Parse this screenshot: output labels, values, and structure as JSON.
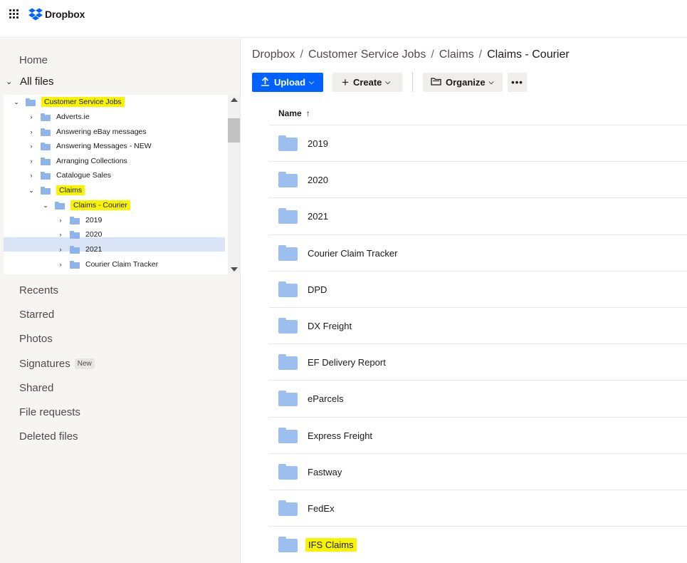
{
  "app": {
    "brand": "Dropbox"
  },
  "sidebar": {
    "home": "Home",
    "all_files": "All files",
    "tree": [
      {
        "label": "Customer Service Jobs",
        "expanded": true,
        "highlight": true
      },
      {
        "label": "Adverts.ie"
      },
      {
        "label": "Answering eBay messages"
      },
      {
        "label": "Answering Messages - NEW"
      },
      {
        "label": "Arranging Collections"
      },
      {
        "label": "Catalogue Sales"
      },
      {
        "label": "Claims",
        "expanded": true,
        "highlight": true
      },
      {
        "label": "Claims - Courier",
        "expanded": true,
        "highlight": true,
        "selected": true
      },
      {
        "label": "2019"
      },
      {
        "label": "2020"
      },
      {
        "label": "2021"
      },
      {
        "label": "Courier Claim Tracker"
      }
    ],
    "recents": "Recents",
    "starred": "Starred",
    "photos": "Photos",
    "signatures": "Signatures",
    "new_badge": "New",
    "shared": "Shared",
    "file_requests": "File requests",
    "deleted_files": "Deleted files"
  },
  "breadcrumb": {
    "items": [
      "Dropbox",
      "Customer Service Jobs",
      "Claims"
    ],
    "current": "Claims - Courier"
  },
  "toolbar": {
    "upload": "Upload",
    "create": "Create",
    "organize": "Organize",
    "more": "•••"
  },
  "list": {
    "column_name": "Name",
    "sort_arrow": "↑",
    "files": [
      "2019",
      "2020",
      "2021",
      "Courier Claim Tracker",
      "DPD",
      "DX Freight",
      "EF Delivery Report",
      "eParcels",
      "Express Freight",
      "Fastway",
      "FedEx",
      "IFS Claims"
    ]
  },
  "colors": {
    "accent": "#0061fe",
    "highlight": "#f8f400",
    "folder": "#9cbff0",
    "selected_row": "#d9e4f7"
  }
}
